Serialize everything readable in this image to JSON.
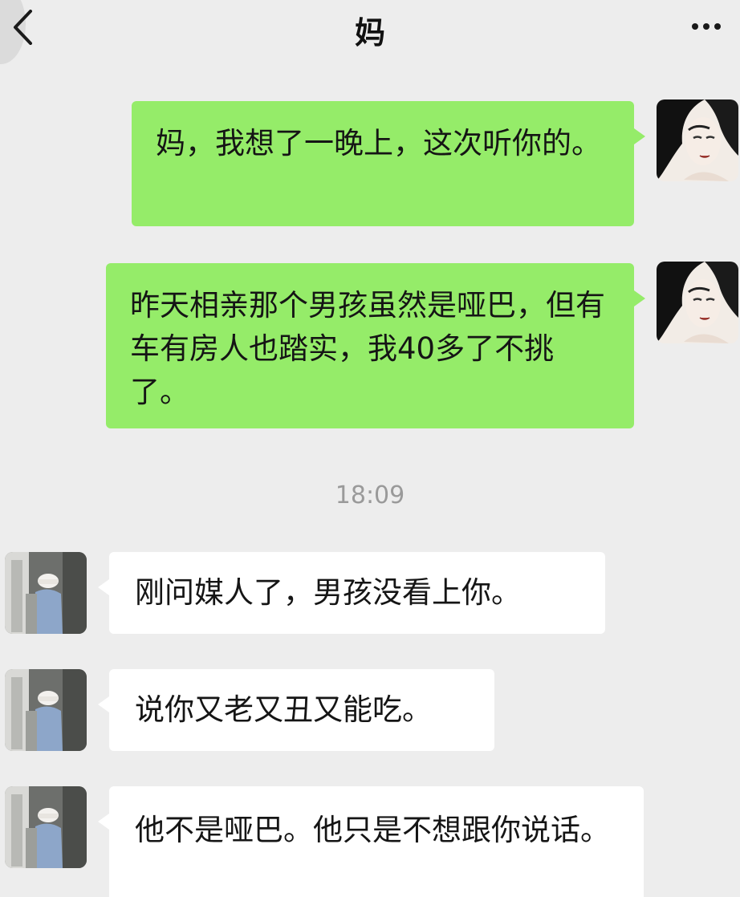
{
  "header": {
    "title": "妈"
  },
  "timestamp": "18:09",
  "messages": [
    {
      "text": "妈，我想了一晚上，这次听你的。"
    },
    {
      "text": "昨天相亲那个男孩虽然是哑巴，但有车有房人也踏实，我40多了不挑了。"
    },
    {
      "text": "刚问媒人了，男孩没看上你。"
    },
    {
      "text": "说你又老又丑又能吃。"
    },
    {
      "text": "他不是哑巴。他只是不想跟你说话。"
    }
  ]
}
